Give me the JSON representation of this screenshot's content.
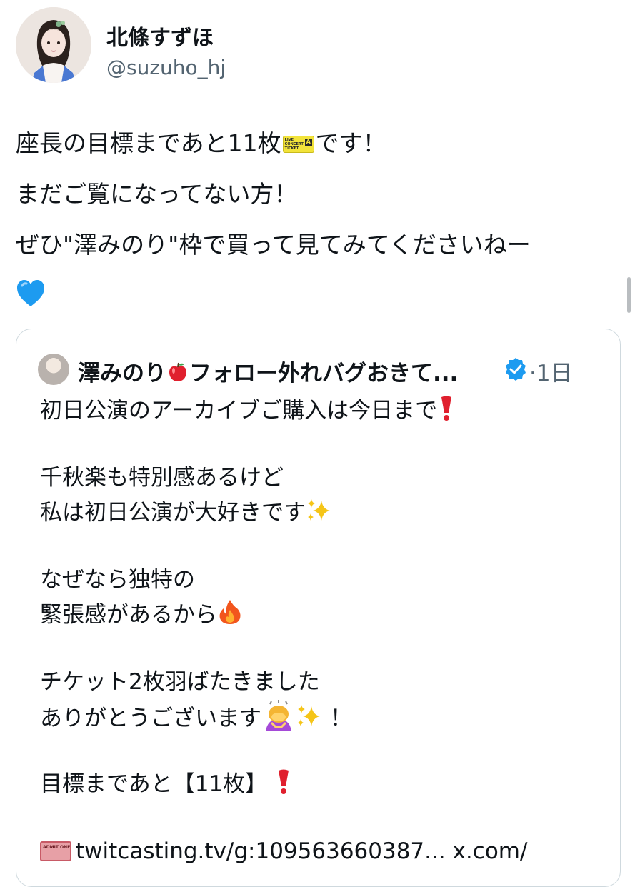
{
  "author": {
    "name": "北條すずほ",
    "handle": "@suzuho_hj",
    "avatar_icon": "profile-photo"
  },
  "tweet": {
    "line1_before": "座長の目標まであと11枚",
    "line1_icon": "ticket-icon",
    "line1_after": "です！",
    "line2": "まだご覧になってない方！",
    "line3": "ぜひ\"澤みのり\"枠で買って見てみてくださいねー",
    "line4_icon": "blue-heart-icon"
  },
  "ticket_icon": {
    "text": "LIVE\nCONCERT\nTICKET",
    "badge": "A"
  },
  "quote": {
    "name_before": "澤みのり",
    "name_icon": "red-apple-icon",
    "name_after": "フォロー外れバグおきて...",
    "verified_icon": "verified-badge-icon",
    "time": "·1日",
    "lines": [
      "初日公演のアーカイブご購入は今日まで",
      "千秋楽も特別感あるけど",
      "私は初日公演が大好きです",
      "なぜなら独特の",
      "緊張感があるから",
      "チケット2枚羽ばたきました",
      "ありがとうございます",
      "！",
      "目標まであと【11枚】",
      "twitcasting.tv/g:109563660387... x.com/"
    ],
    "admit_label": "ADMIT ONE"
  },
  "colors": {
    "text": "#0f1419",
    "secondary": "#536471",
    "border": "#cfd9de",
    "verified": "#1d9bf0",
    "heart": "#1d9bf0",
    "exclaim": "#e0202e"
  }
}
